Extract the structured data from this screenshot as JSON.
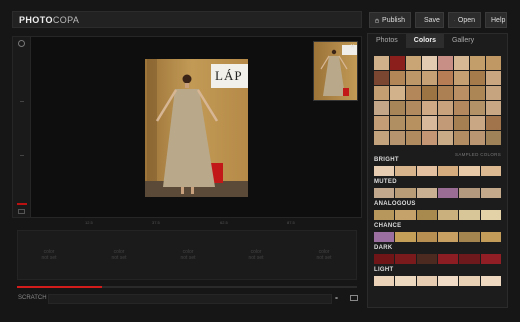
{
  "app": {
    "logo_bold": "PHOTO",
    "logo_light": "COPA"
  },
  "toolbar": {
    "publish": "Publish",
    "save": "Save",
    "open": "Open",
    "help": "Help"
  },
  "viewer": {
    "sign_text": "LÁP",
    "ticks": [
      "12.5",
      "37.5",
      "62.5",
      "87.5"
    ]
  },
  "swatches": [
    {
      "line1": "color",
      "line2": "not set"
    },
    {
      "line1": "color",
      "line2": "not set"
    },
    {
      "line1": "color",
      "line2": "not set"
    },
    {
      "line1": "color",
      "line2": "not set"
    },
    {
      "line1": "color",
      "line2": "not set"
    }
  ],
  "progress": 0.25,
  "scratch": {
    "label": "SCRATCH"
  },
  "panel": {
    "tabs": [
      "Photos",
      "Colors",
      "Gallery"
    ],
    "active_tab": "Colors",
    "sampled_label": "SAMPLED COLORS",
    "grid": [
      "#cfb08a",
      "#8a1f1c",
      "#c9a575",
      "#e2cbb0",
      "#c78f86",
      "#d7b895",
      "#c39d6a",
      "#bf9863",
      "#7a4531",
      "#b28657",
      "#bd9767",
      "#c7a176",
      "#b77d55",
      "#c59f72",
      "#a67b4c",
      "#c9a67f",
      "#c39e72",
      "#d1b28b",
      "#b4875a",
      "#9c7343",
      "#ad8054",
      "#b98f63",
      "#ad8655",
      "#c6a47f",
      "#c3a588",
      "#a88459",
      "#b28a5f",
      "#cfa885",
      "#c8a27d",
      "#b4885e",
      "#b49268",
      "#c7a784",
      "#c39d76",
      "#b09063",
      "#b7915f",
      "#d8b89a",
      "#c39a78",
      "#a57f52",
      "#c9a784",
      "#a1744c",
      "#c2a37d",
      "#b6946e",
      "#b08b60",
      "#c59673",
      "#c9ab87",
      "#b28d63",
      "#ba9772",
      "#a08259"
    ],
    "sections": [
      {
        "name": "BRIGHT",
        "colors": [
          "#e7cdb2",
          "#d8b48d",
          "#e3c1a0",
          "#d4ac7e",
          "#e8caa8",
          "#dcb991"
        ]
      },
      {
        "name": "MUTED",
        "colors": [
          "#c2a98e",
          "#b89c78",
          "#c9b092",
          "#9a6d95",
          "#b39a7e",
          "#c4a98a"
        ]
      },
      {
        "name": "ANALOGOUS",
        "colors": [
          "#b8975d",
          "#c4a26a",
          "#a88a4e",
          "#c9b07c",
          "#d8c598",
          "#e3d1a8"
        ]
      },
      {
        "name": "CHANCE",
        "colors": [
          "#9b6fa0",
          "#c49f57",
          "#b88f52",
          "#c7a062",
          "#a4854f",
          "#c39c5a"
        ]
      },
      {
        "name": "DARK",
        "colors": [
          "#6f1518",
          "#7b1a1d",
          "#4d2a1f",
          "#8c1d22",
          "#6e1a1c",
          "#921e25"
        ]
      },
      {
        "name": "LIGHT",
        "colors": [
          "#e9d2b8",
          "#ecd7bf",
          "#e6ccb0",
          "#f0dcc6",
          "#e8d0b5",
          "#eed8c0"
        ]
      }
    ]
  }
}
